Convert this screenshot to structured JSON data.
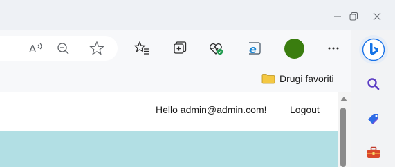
{
  "favorites_bar": {
    "folder_label": "Drugi favoriti"
  },
  "page": {
    "greeting": "Hello admin@admin.com!",
    "logout_label": "Logout"
  },
  "toolbar": {
    "icons": [
      "read-aloud-icon",
      "zoom-out-icon",
      "favorite-star-icon",
      "favorites-list-icon",
      "collections-icon",
      "browser-essentials-icon",
      "internet-explorer-mode-icon",
      "profile-avatar",
      "more-options-icon",
      "bing-copilot-icon"
    ]
  },
  "sidebar": {
    "icons": [
      "search-icon",
      "shopping-tag-icon",
      "tools-briefcase-icon"
    ]
  },
  "colors": {
    "profile_avatar": "#3a7d0f",
    "page_band": "#b2dfe4",
    "folder": "#f4c842"
  }
}
